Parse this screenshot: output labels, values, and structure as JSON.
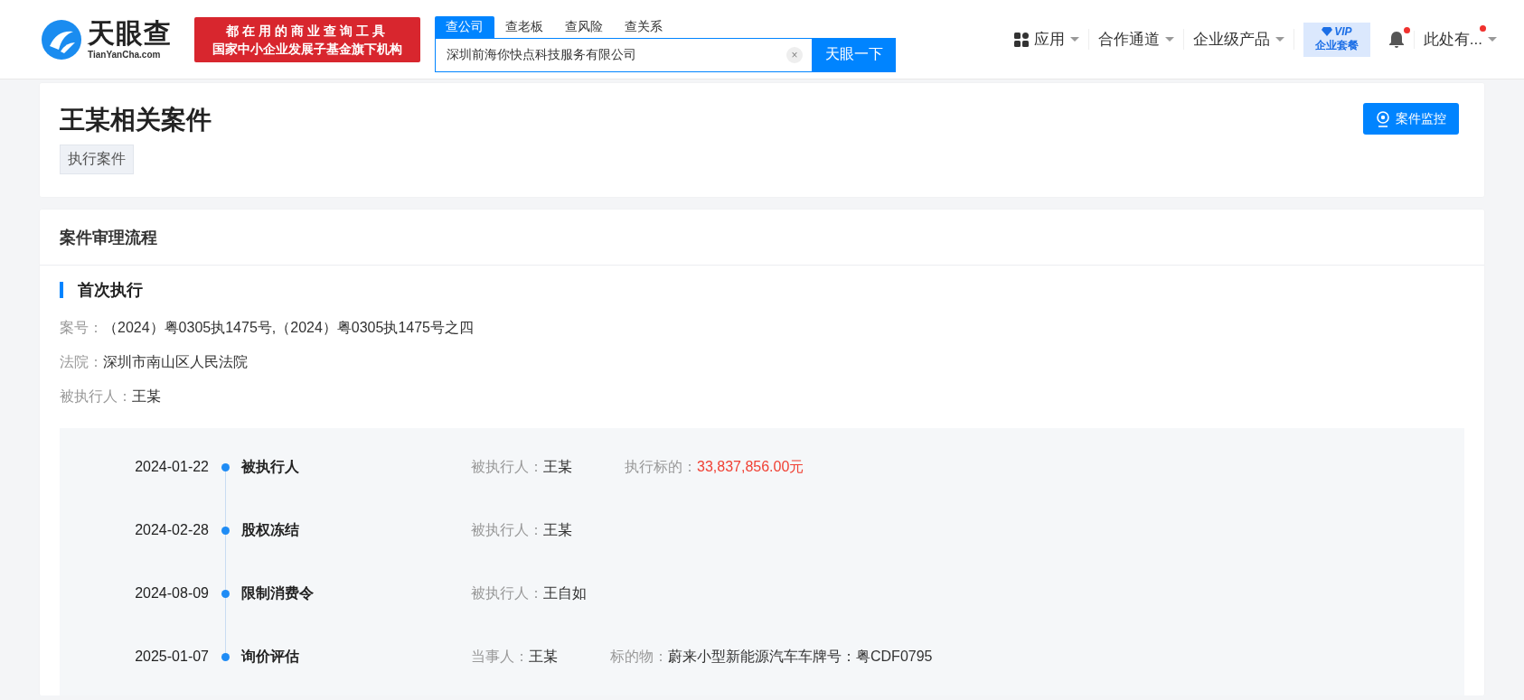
{
  "header": {
    "logo": {
      "name": "天眼查",
      "domain": "TianYanCha.com"
    },
    "banner": [
      "都在用的商业查询工具",
      "国家中小企业发展子基金旗下机构"
    ],
    "search": {
      "tabs": [
        {
          "label": "查公司",
          "selected": true
        },
        {
          "label": "查老板",
          "selected": false
        },
        {
          "label": "查风险",
          "selected": false
        },
        {
          "label": "查关系",
          "selected": false
        }
      ],
      "value": "深圳前海你快点科技服务有限公司",
      "clear": "×",
      "button": "天眼一下"
    },
    "nav": [
      {
        "kind": "apps",
        "label": "应用"
      },
      {
        "kind": "menu",
        "label": "合作通道"
      },
      {
        "kind": "menu",
        "label": "企业级产品"
      },
      {
        "kind": "vip",
        "label": "VIP",
        "sublabel": "企业套餐"
      },
      {
        "kind": "bell",
        "unread": true
      },
      {
        "kind": "user",
        "label": "此处有...",
        "unread": true
      }
    ]
  },
  "case": {
    "title": "王某相关案件",
    "tag": "执行案件",
    "monitor_button": "案件监控"
  },
  "process": {
    "title": "案件审理流程",
    "stage": "首次执行",
    "info": [
      {
        "label": "案号：",
        "value": "（2024）粤0305执1475号,（2024）粤0305执1475号之四"
      },
      {
        "label": "法院：",
        "value": "深圳市南山区人民法院"
      },
      {
        "label": "被执行人：",
        "value": "王某"
      }
    ],
    "timeline": [
      {
        "date": "2024-01-22",
        "event": "被执行人",
        "fields": [
          {
            "label": "被执行人：",
            "value": "王某",
            "kind": "plain"
          },
          {
            "label": "执行标的：",
            "value": "33,837,856.00元",
            "kind": "amount"
          }
        ]
      },
      {
        "date": "2024-02-28",
        "event": "股权冻结",
        "fields": [
          {
            "label": "被执行人：",
            "value": "王某",
            "kind": "plain"
          }
        ]
      },
      {
        "date": "2024-08-09",
        "event": "限制消费令",
        "fields": [
          {
            "label": "被执行人：",
            "value": "王自如",
            "kind": "plain"
          }
        ]
      },
      {
        "date": "2025-01-07",
        "event": "询价评估",
        "fields": [
          {
            "label": "当事人：",
            "value": "王某",
            "kind": "plain"
          },
          {
            "label": "标的物：",
            "value": "蔚来小型新能源汽车车牌号：粤CDF0795",
            "kind": "plain"
          }
        ]
      }
    ]
  }
}
